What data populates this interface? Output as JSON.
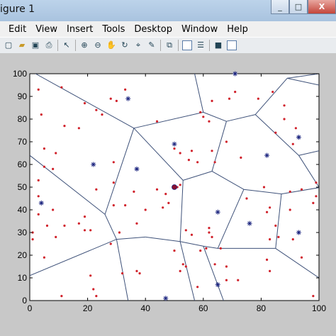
{
  "window": {
    "title": "igure 1"
  },
  "window_buttons": [
    "_",
    "□",
    "X"
  ],
  "menu": [
    "Edit",
    "View",
    "Insert",
    "Tools",
    "Desktop",
    "Window",
    "Help"
  ],
  "toolbar_icons": [
    "new-file-icon",
    "open-folder-icon",
    "save-icon",
    "print-icon",
    "pointer-icon",
    "zoom-in-icon",
    "zoom-out-icon",
    "pan-hand-icon",
    "rotate-3d-icon",
    "data-cursor-icon",
    "brush-icon",
    "link-icon",
    "colorbar-icon",
    "legend-icon",
    "hide-tools-icon",
    "show-tools-icon"
  ],
  "chart_data": {
    "type": "scatter",
    "xlim": [
      0,
      100
    ],
    "ylim": [
      0,
      100
    ],
    "xticks": [
      "0",
      "20",
      "40",
      "60",
      "80",
      "100"
    ],
    "yticks": [
      "0",
      "10",
      "20",
      "30",
      "40",
      "50",
      "60",
      "70",
      "80",
      "90",
      "100"
    ],
    "grid": false,
    "colors": {
      "points": "#d0202a",
      "sites": "#1a237e",
      "edges": "#3e5179"
    },
    "sites": [
      [
        50,
        50
      ],
      [
        22,
        60
      ],
      [
        37,
        58
      ],
      [
        50,
        69
      ],
      [
        34,
        89
      ],
      [
        4,
        43
      ],
      [
        65,
        39
      ],
      [
        76,
        34
      ],
      [
        82,
        64
      ],
      [
        93,
        72
      ],
      [
        93,
        30
      ],
      [
        65,
        7
      ],
      [
        47,
        1
      ],
      [
        71,
        100
      ]
    ],
    "points": [
      [
        3,
        93
      ],
      [
        11,
        94
      ],
      [
        19,
        87
      ],
      [
        4,
        82
      ],
      [
        12,
        77
      ],
      [
        17,
        76
      ],
      [
        28,
        89
      ],
      [
        30,
        88
      ],
      [
        33,
        93
      ],
      [
        23,
        84
      ],
      [
        25,
        82
      ],
      [
        5,
        67
      ],
      [
        9,
        65
      ],
      [
        5,
        59
      ],
      [
        8,
        58
      ],
      [
        3,
        53
      ],
      [
        3,
        46
      ],
      [
        8,
        40
      ],
      [
        3,
        38
      ],
      [
        6,
        33
      ],
      [
        1,
        30
      ],
      [
        1,
        27
      ],
      [
        9,
        28
      ],
      [
        19,
        37
      ],
      [
        17,
        34
      ],
      [
        12,
        33
      ],
      [
        19,
        31
      ],
      [
        21,
        31
      ],
      [
        5,
        19
      ],
      [
        29,
        61
      ],
      [
        23,
        49
      ],
      [
        29,
        52
      ],
      [
        29,
        42
      ],
      [
        36,
        48
      ],
      [
        33,
        42
      ],
      [
        37,
        34
      ],
      [
        44,
        49
      ],
      [
        47,
        47
      ],
      [
        31,
        30
      ],
      [
        28,
        25
      ],
      [
        21,
        11
      ],
      [
        22,
        5
      ],
      [
        23,
        2
      ],
      [
        37,
        13
      ],
      [
        38,
        12
      ],
      [
        11,
        2
      ],
      [
        32,
        12
      ],
      [
        46,
        41
      ],
      [
        48,
        43
      ],
      [
        51,
        50
      ],
      [
        52,
        51
      ],
      [
        55,
        62
      ],
      [
        58,
        61
      ],
      [
        52,
        65
      ],
      [
        56,
        66
      ],
      [
        50,
        67
      ],
      [
        59,
        83
      ],
      [
        60,
        81
      ],
      [
        62,
        79
      ],
      [
        63,
        88
      ],
      [
        69,
        89
      ],
      [
        71,
        92
      ],
      [
        68,
        70
      ],
      [
        63,
        66
      ],
      [
        64,
        61
      ],
      [
        73,
        63
      ],
      [
        81,
        50
      ],
      [
        75,
        45
      ],
      [
        82,
        39
      ],
      [
        83,
        41
      ],
      [
        85,
        33
      ],
      [
        90,
        48
      ],
      [
        90,
        40
      ],
      [
        94,
        49
      ],
      [
        98,
        43
      ],
      [
        83,
        27
      ],
      [
        86,
        28
      ],
      [
        91,
        27
      ],
      [
        94,
        19
      ],
      [
        99,
        52
      ],
      [
        85,
        74
      ],
      [
        88,
        80
      ],
      [
        92,
        76
      ],
      [
        79,
        89
      ],
      [
        88,
        86
      ],
      [
        91,
        69
      ],
      [
        84,
        92
      ],
      [
        62,
        32
      ],
      [
        62,
        30
      ],
      [
        63,
        28
      ],
      [
        61,
        23
      ],
      [
        59,
        22
      ],
      [
        54,
        31
      ],
      [
        56,
        29
      ],
      [
        50,
        22
      ],
      [
        53,
        16
      ],
      [
        54,
        15
      ],
      [
        52,
        13
      ],
      [
        66,
        23
      ],
      [
        68,
        15
      ],
      [
        64,
        16
      ],
      [
        68,
        9
      ],
      [
        72,
        9
      ],
      [
        58,
        6
      ],
      [
        82,
        18
      ],
      [
        83,
        13
      ],
      [
        98,
        2
      ],
      [
        44,
        79
      ],
      [
        40,
        40
      ],
      [
        99,
        46
      ]
    ],
    "voronoi_edges": [
      [
        [
          2,
          100
        ],
        [
          36,
          76
        ]
      ],
      [
        [
          36,
          76
        ],
        [
          60,
          83
        ]
      ],
      [
        [
          60,
          83
        ],
        [
          57,
          100
        ]
      ],
      [
        [
          36,
          76
        ],
        [
          26,
          38
        ]
      ],
      [
        [
          26,
          38
        ],
        [
          0,
          64
        ]
      ],
      [
        [
          36,
          76
        ],
        [
          53,
          53
        ]
      ],
      [
        [
          53,
          53
        ],
        [
          63,
          57
        ]
      ],
      [
        [
          63,
          57
        ],
        [
          68,
          79
        ]
      ],
      [
        [
          68,
          79
        ],
        [
          60,
          83
        ]
      ],
      [
        [
          68,
          79
        ],
        [
          78,
          82
        ]
      ],
      [
        [
          78,
          82
        ],
        [
          89,
          98
        ]
      ],
      [
        [
          89,
          98
        ],
        [
          100,
          100
        ]
      ],
      [
        [
          89,
          98
        ],
        [
          100,
          95
        ]
      ],
      [
        [
          78,
          82
        ],
        [
          93,
          64
        ]
      ],
      [
        [
          93,
          64
        ],
        [
          100,
          66
        ]
      ],
      [
        [
          93,
          64
        ],
        [
          101,
          48
        ]
      ],
      [
        [
          63,
          57
        ],
        [
          74,
          49
        ]
      ],
      [
        [
          74,
          49
        ],
        [
          87,
          47
        ]
      ],
      [
        [
          87,
          47
        ],
        [
          101,
          50
        ]
      ],
      [
        [
          87,
          47
        ],
        [
          85,
          23
        ]
      ],
      [
        [
          85,
          23
        ],
        [
          100,
          10
        ]
      ],
      [
        [
          85,
          23
        ],
        [
          65,
          23
        ]
      ],
      [
        [
          65,
          23
        ],
        [
          74,
          49
        ]
      ],
      [
        [
          65,
          23
        ],
        [
          60,
          24
        ]
      ],
      [
        [
          60,
          24
        ],
        [
          52,
          26
        ]
      ],
      [
        [
          52,
          26
        ],
        [
          53,
          53
        ]
      ],
      [
        [
          52,
          26
        ],
        [
          40,
          28
        ]
      ],
      [
        [
          40,
          28
        ],
        [
          30,
          27
        ]
      ],
      [
        [
          30,
          27
        ],
        [
          26,
          38
        ]
      ],
      [
        [
          30,
          27
        ],
        [
          0,
          11
        ]
      ],
      [
        [
          30,
          27
        ],
        [
          34,
          0
        ]
      ],
      [
        [
          52,
          26
        ],
        [
          57,
          0
        ]
      ],
      [
        [
          60,
          24
        ],
        [
          67,
          0
        ]
      ]
    ]
  }
}
